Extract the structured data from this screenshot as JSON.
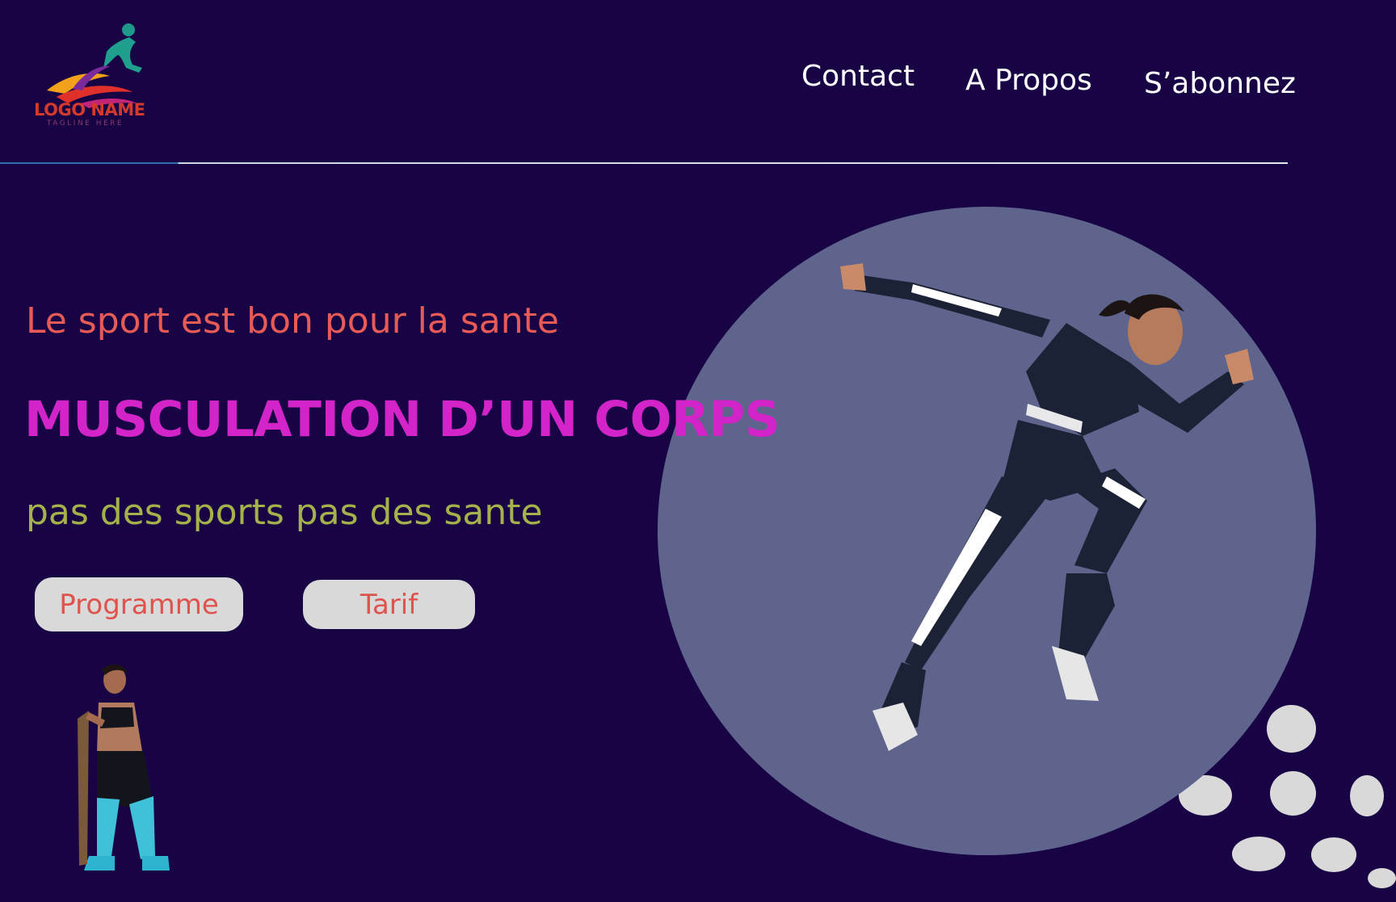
{
  "logo": {
    "name": "LOGO NAME",
    "tagline": "TAGLINE HERE"
  },
  "nav": {
    "items": [
      {
        "label": "Contact"
      },
      {
        "label": "A Propos"
      },
      {
        "label": "S’abonnez"
      }
    ]
  },
  "hero": {
    "subtitle": "Le sport est bon pour la sante",
    "title": "MUSCULATION D’UN CORPS",
    "tagline": "pas des sports pas des sante",
    "buttons": [
      {
        "label": "Programme"
      },
      {
        "label": "Tarif"
      }
    ]
  },
  "colors": {
    "background": "#180445",
    "subtitle": "#e85a56",
    "title": "#d324c9",
    "tagline": "#a5b14a",
    "button_bg": "#d9d9d9",
    "button_text": "#e0524c",
    "circle": "#5e648c"
  }
}
